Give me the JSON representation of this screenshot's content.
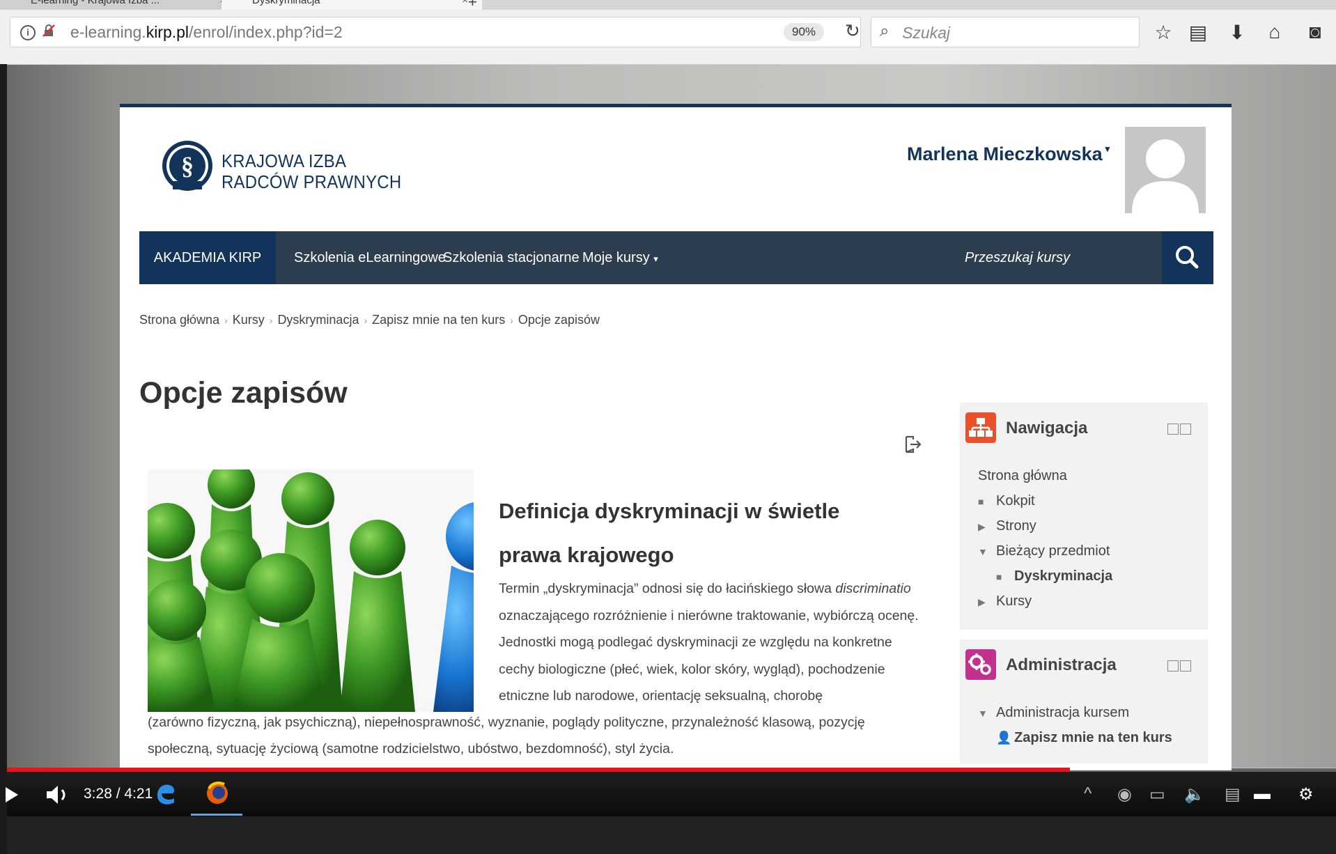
{
  "browser": {
    "tabs": [
      {
        "label": "E-learning - Krajowa Izba ..."
      },
      {
        "label": "Dyskryminacja"
      }
    ],
    "url_prefix": "e-learning.",
    "url_domain": "kirp.pl",
    "url_path": "/enrol/index.php?id=2",
    "zoom": "90%",
    "search_placeholder": "Szukaj",
    "icons": [
      "bookmark-star-icon",
      "reading-list-icon",
      "download-icon",
      "home-icon",
      "pocket-icon"
    ]
  },
  "site": {
    "logo_line1": "KRAJOWA IZBA",
    "logo_line2": "RADCÓW PRAWNYCH",
    "logo_badge": "KIRP",
    "user_name": "Marlena Mieczkowska",
    "nav": {
      "home": "AKADEMIA KIRP",
      "items": [
        "Szkolenia eLearningowe",
        "Szkolenia stacjonarne",
        "Moje kursy"
      ],
      "search_placeholder": "Przeszukaj kursy"
    },
    "breadcrumbs": [
      "Strona główna",
      "Kursy",
      "Dyskryminacja",
      "Zapisz mnie na ten kurs",
      "Opcje zapisów"
    ],
    "page_title": "Opcje zapisów",
    "course": {
      "title": "Definicja dyskryminacji w świetle prawa krajowego",
      "para_a": "Termin „dyskryminacja” odnosi się do łacińskiego słowa ",
      "para_em": "discriminatio",
      "para_b": " oznaczającego rozróżnienie i nierówne traktowanie, wybiórczą ocenę. Jednostki mogą podlegać dyskryminacji ze względu na konkretne cechy biologiczne (płeć, wiek, kolor skóry, wygląd), pochodzenie etniczne lub narodowe, orientację seksualną, chorobę",
      "para_c": "(zarówno fizyczną, jak psychiczną), niepełnosprawność, wyznanie, poglądy polityczne, przynależność klasową, pozycję społeczną, sytuację życiową (samotne rodzicielstwo, ubóstwo, bezdomność), styl życia."
    },
    "blocks": {
      "navigation": {
        "title": "Nawigacja",
        "root": "Strona główna",
        "items": [
          "Kokpit",
          "Strony",
          "Bieżący przedmiot",
          "Dyskryminacja",
          "Kursy"
        ]
      },
      "administration": {
        "title": "Administracja",
        "items": [
          "Administracja kursem",
          "Zapisz mnie na ten kurs"
        ]
      }
    }
  },
  "player": {
    "time": "3:28 / 4:21",
    "progress": 0.8,
    "icons": [
      "play-icon",
      "volume-icon",
      "edge-icon",
      "firefox-icon",
      "chevron-up-icon",
      "network-icon",
      "speaker-icon",
      "notification-icon",
      "captions-icon",
      "settings-icon"
    ]
  },
  "colors": {
    "brand_navy": "#12345a",
    "nav_bg": "#2d3e50",
    "nav_icon": "#e8512b",
    "admin_icon": "#c2318d",
    "progress": "#e5161a"
  }
}
